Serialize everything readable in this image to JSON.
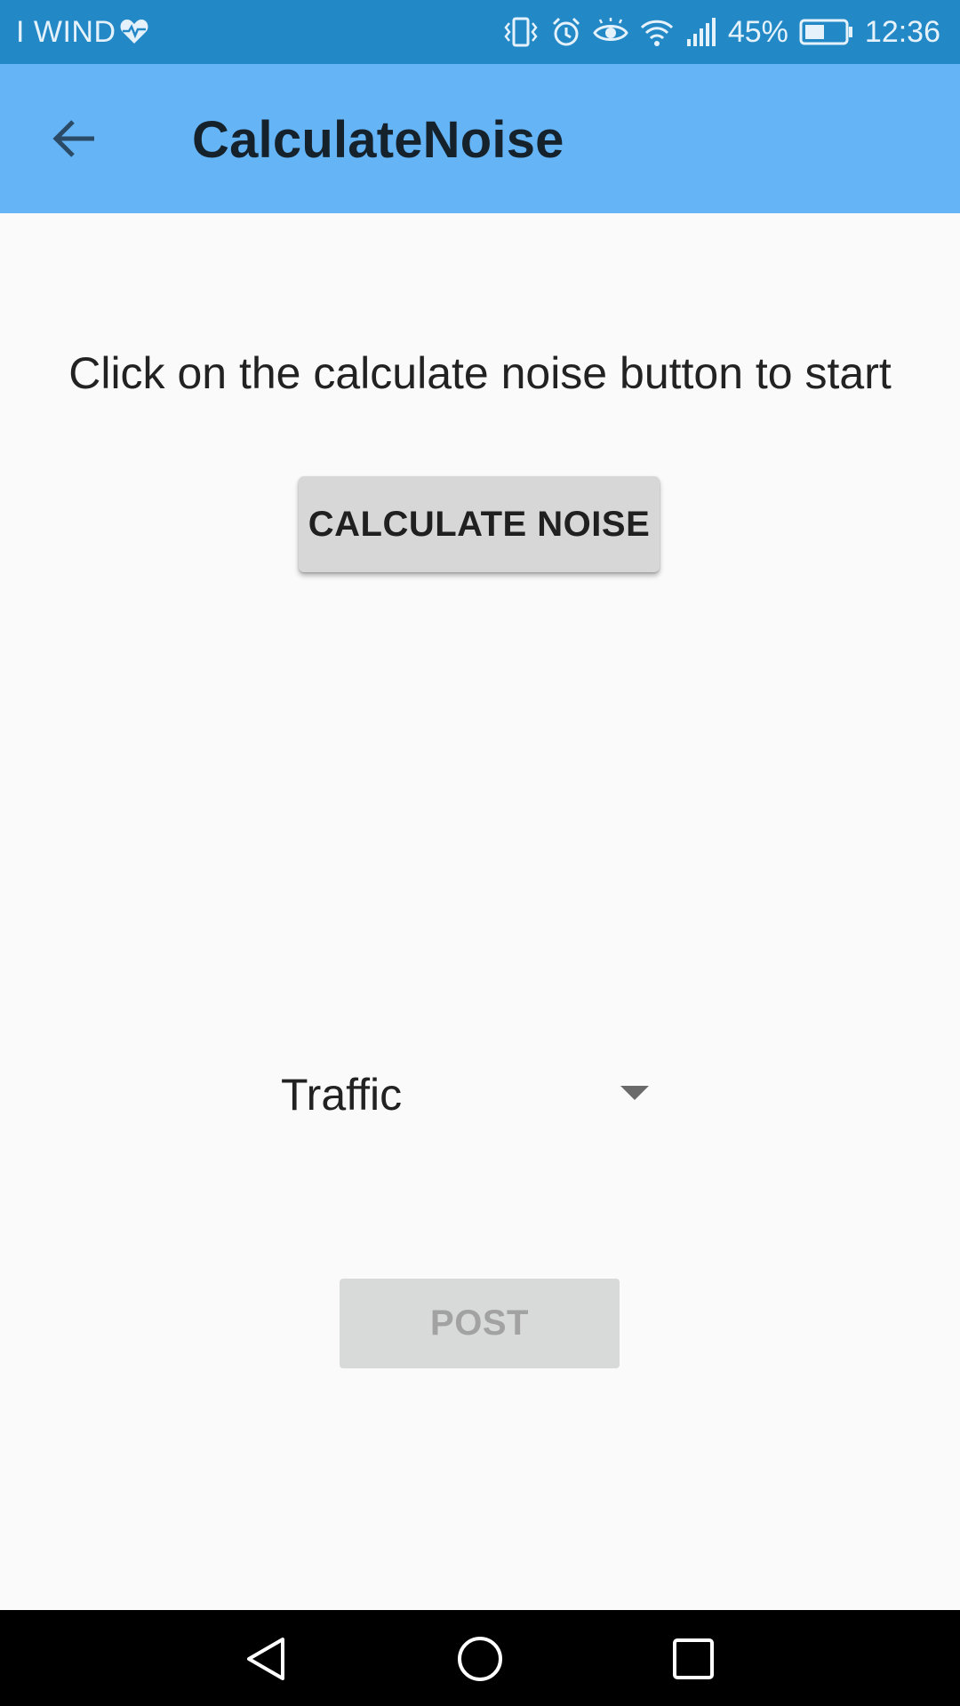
{
  "status_bar": {
    "carrier": "I WIND",
    "battery_percent": "45%",
    "time": "12:36",
    "icons": [
      "heart-pulse-icon",
      "vibrate-icon",
      "alarm-icon",
      "eye-icon",
      "wifi-icon",
      "signal-icon",
      "battery-icon"
    ],
    "background_color": "#2389c6"
  },
  "app_bar": {
    "title": "CalculateNoise",
    "back_icon": "arrow-back-icon",
    "background_color": "#64b4f6"
  },
  "main": {
    "instruction": "Click on the calculate noise button to start",
    "calculate_button_label": "CALCULATE NOISE",
    "noise_type_selected": "Traffic",
    "post_button_label": "POST",
    "post_button_enabled": false
  },
  "nav_bar": {
    "icons": [
      "back-triangle-icon",
      "home-circle-icon",
      "recents-square-icon"
    ]
  }
}
